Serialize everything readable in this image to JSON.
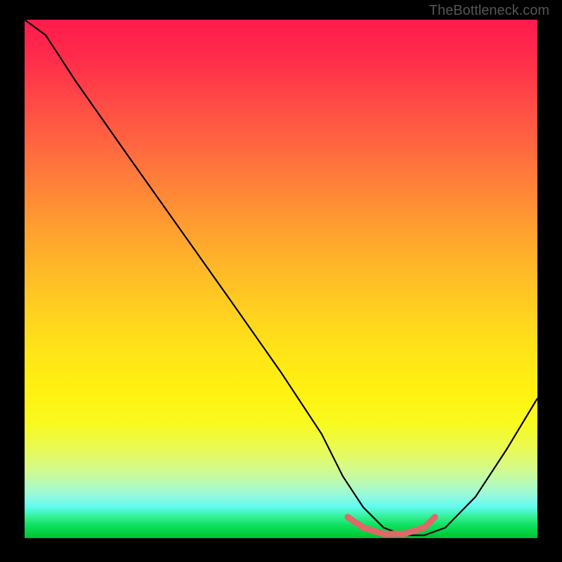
{
  "watermark": "TheBottleneck.com",
  "chart_data": {
    "type": "line",
    "title": "",
    "xlabel": "",
    "ylabel": "",
    "xlim": [
      0,
      100
    ],
    "ylim": [
      0,
      100
    ],
    "series": [
      {
        "name": "bottleneck-curve",
        "x": [
          0,
          4,
          10,
          20,
          30,
          40,
          50,
          58,
          62,
          66,
          70,
          74,
          78,
          82,
          88,
          94,
          100
        ],
        "y": [
          100,
          97,
          88,
          74,
          60,
          46,
          32,
          20,
          12,
          6,
          2,
          0.5,
          0.5,
          2,
          8,
          17,
          27
        ],
        "color": "#000000"
      },
      {
        "name": "highlight-segment",
        "x": [
          63,
          66,
          70,
          74,
          78,
          80
        ],
        "y": [
          4,
          2,
          0.8,
          0.8,
          2,
          4
        ],
        "color": "#e57373"
      }
    ],
    "gradient_stops": [
      {
        "pos": 0,
        "color": "#ff1a4d"
      },
      {
        "pos": 50,
        "color": "#ffd020"
      },
      {
        "pos": 85,
        "color": "#f8fa20"
      },
      {
        "pos": 100,
        "color": "#00c030"
      }
    ]
  }
}
